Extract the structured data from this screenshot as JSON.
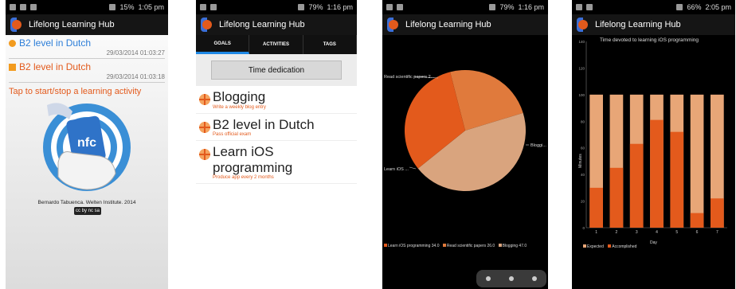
{
  "status": {
    "p1": {
      "battery": "15%",
      "time": "1:05 pm"
    },
    "p2": {
      "battery": "79%",
      "time": "1:16 pm"
    },
    "p3": {
      "battery": "79%",
      "time": "1:16 pm"
    },
    "p4": {
      "battery": "66%",
      "time": "2:05 pm"
    }
  },
  "app_title": "Lifelong Learning Hub",
  "phone1": {
    "activities": [
      {
        "label": "B2 level in Dutch",
        "timestamp": "29/03/2014 01:03:27",
        "color": "#2d7ed8",
        "marker": "circle"
      },
      {
        "label": "B2 level in Dutch",
        "timestamp": "29/03/2014 01:03:18",
        "color": "#e35a1c",
        "marker": "square"
      }
    ],
    "tap_text": "Tap to start/stop a learning activity",
    "nfc_label": "nfc",
    "credit": "Bernardo Tabuenca. Welten Institute. 2014",
    "license_badge": "cc by nc sa"
  },
  "phone2": {
    "tabs": [
      {
        "label": "GOALS",
        "active": true
      },
      {
        "label": "ACTIVITIES",
        "active": false
      },
      {
        "label": "TAGS",
        "active": false
      }
    ],
    "button": "Time dedication",
    "goals": [
      {
        "title": "Blogging",
        "desc": "Write a weekly blog entry"
      },
      {
        "title": "B2 level in Dutch",
        "desc": "Pass official exam"
      },
      {
        "title": "Learn iOS programming",
        "desc": "Produce app every 2 months"
      }
    ]
  },
  "phone3": {
    "chart_data": {
      "type": "pie",
      "slices": [
        {
          "name": "Learn iOS programming",
          "value": 34.0,
          "color": "#e35a1c"
        },
        {
          "name": "Read scientific papers",
          "value": 26.0,
          "color": "#e07a3c"
        },
        {
          "name": "Blogging",
          "value": 47.0,
          "color": "#d9a47e"
        }
      ],
      "slice_labels": [
        "Read scientific papers 2...",
        "Learn iOS ...",
        "Bloggi..."
      ],
      "legend": [
        "Learn iOS programming 34.0",
        "Read scientific papers 26.0",
        "Blogging 47.0"
      ]
    }
  },
  "phone4": {
    "chart_data": {
      "type": "bar",
      "title": "Time devoted to learning iOS programming",
      "xlabel": "Day",
      "ylabel": "Minutes",
      "categories": [
        "1",
        "2",
        "3",
        "4",
        "5",
        "6",
        "7"
      ],
      "ylim": [
        0,
        140
      ],
      "series": [
        {
          "name": "Expected",
          "values": [
            100,
            100,
            100,
            100,
            100,
            100,
            100
          ],
          "color": "#e8a677"
        },
        {
          "name": "Accomplished",
          "values": [
            30,
            45,
            63,
            81,
            72,
            11,
            22
          ],
          "color": "#e35a1c"
        }
      ],
      "yticks": [
        "140",
        "120",
        "100",
        "80",
        "60",
        "40",
        "20",
        "0"
      ]
    }
  }
}
